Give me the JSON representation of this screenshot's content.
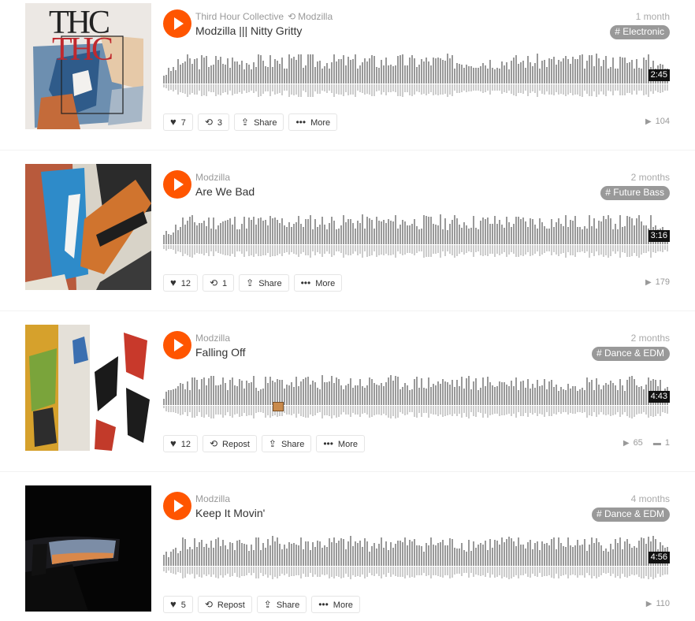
{
  "tracks": [
    {
      "uploader": "Third Hour Collective",
      "reposter": "Modzilla",
      "title": "Modzilla ||| Nitty Gritty",
      "time_ago": "1 month",
      "tag": "# Electronic",
      "duration": "2:45",
      "likes": "7",
      "reposts_label": "3",
      "share_label": "Share",
      "more_label": "More",
      "plays": "104",
      "comments": "",
      "art_text": "THC"
    },
    {
      "uploader": "Modzilla",
      "reposter": "",
      "title": "Are We Bad",
      "time_ago": "2 months",
      "tag": "# Future Bass",
      "duration": "3:16",
      "likes": "12",
      "reposts_label": "1",
      "share_label": "Share",
      "more_label": "More",
      "plays": "179",
      "comments": ""
    },
    {
      "uploader": "Modzilla",
      "reposter": "",
      "title": "Falling Off",
      "time_ago": "2 months",
      "tag": "# Dance & EDM",
      "duration": "4:43",
      "likes": "12",
      "reposts_label": "Repost",
      "share_label": "Share",
      "more_label": "More",
      "plays": "65",
      "comments": "1"
    },
    {
      "uploader": "Modzilla",
      "reposter": "",
      "title": "Keep It Movin'",
      "time_ago": "4 months",
      "tag": "# Dance & EDM",
      "duration": "4:56",
      "likes": "5",
      "reposts_label": "Repost",
      "share_label": "Share",
      "more_label": "More",
      "plays": "110",
      "comments": ""
    }
  ],
  "colors": {
    "accent": "#ff5500",
    "waveform": "#999999",
    "waveform_reflection": "#cccccc",
    "tag_bg": "#999999"
  },
  "icons": {
    "play": "play-icon",
    "repost": "repost-icon",
    "like": "heart-icon",
    "share": "share-icon",
    "more": "more-dots-icon",
    "plays": "play-count-icon",
    "comments": "comment-icon"
  }
}
